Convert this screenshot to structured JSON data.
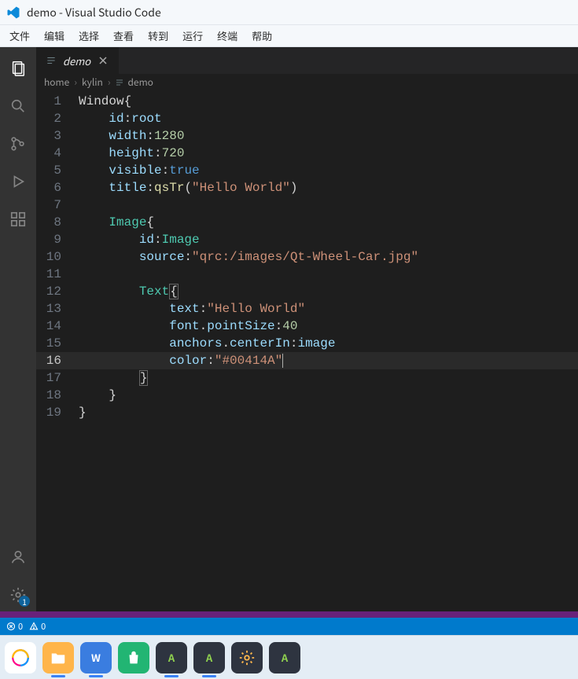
{
  "window": {
    "title": "demo - Visual Studio Code"
  },
  "menu": {
    "items": [
      "文件",
      "编辑",
      "选择",
      "查看",
      "转到",
      "运行",
      "终端",
      "帮助"
    ]
  },
  "activitybar": {
    "settings_badge": "1"
  },
  "tabs": [
    {
      "name": "demo"
    }
  ],
  "breadcrumbs": [
    "home",
    "kylin",
    "demo"
  ],
  "editor": {
    "lines": 19,
    "current_line": 16,
    "code": [
      {
        "i": 1,
        "indent": 0,
        "tokens": [
          [
            "ident",
            "Window"
          ],
          [
            "brace",
            "{"
          ]
        ]
      },
      {
        "i": 2,
        "indent": 2,
        "tokens": [
          [
            "attr",
            "id"
          ],
          [
            "plain",
            ":"
          ],
          [
            "val",
            "root"
          ]
        ]
      },
      {
        "i": 3,
        "indent": 2,
        "tokens": [
          [
            "attr",
            "width"
          ],
          [
            "plain",
            ":"
          ],
          [
            "num",
            "1280"
          ]
        ]
      },
      {
        "i": 4,
        "indent": 2,
        "tokens": [
          [
            "attr",
            "height"
          ],
          [
            "plain",
            ":"
          ],
          [
            "num",
            "720"
          ]
        ]
      },
      {
        "i": 5,
        "indent": 2,
        "tokens": [
          [
            "attr",
            "visible"
          ],
          [
            "plain",
            ":"
          ],
          [
            "bool",
            "true"
          ]
        ]
      },
      {
        "i": 6,
        "indent": 2,
        "tokens": [
          [
            "attr",
            "title"
          ],
          [
            "plain",
            ":"
          ],
          [
            "func",
            "qsTr"
          ],
          [
            "plain",
            "("
          ],
          [
            "str",
            "\"Hello World\""
          ],
          [
            "plain",
            ")"
          ]
        ]
      },
      {
        "i": 7,
        "indent": 0,
        "tokens": []
      },
      {
        "i": 8,
        "indent": 2,
        "tokens": [
          [
            "type",
            "Image"
          ],
          [
            "brace",
            "{"
          ]
        ]
      },
      {
        "i": 9,
        "indent": 4,
        "tokens": [
          [
            "attr",
            "id"
          ],
          [
            "plain",
            ":"
          ],
          [
            "type",
            "Image"
          ]
        ]
      },
      {
        "i": 10,
        "indent": 4,
        "tokens": [
          [
            "attr",
            "source"
          ],
          [
            "plain",
            ":"
          ],
          [
            "str",
            "\"qrc:/images/Qt-Wheel-Car.jpg\""
          ]
        ]
      },
      {
        "i": 11,
        "indent": 0,
        "tokens": []
      },
      {
        "i": 12,
        "indent": 4,
        "tokens": [
          [
            "type",
            "Text"
          ],
          [
            "braceHL",
            "{"
          ]
        ]
      },
      {
        "i": 13,
        "indent": 6,
        "tokens": [
          [
            "attr",
            "text"
          ],
          [
            "plain",
            ":"
          ],
          [
            "str",
            "\"Hello World\""
          ]
        ]
      },
      {
        "i": 14,
        "indent": 6,
        "tokens": [
          [
            "attr",
            "font"
          ],
          [
            "plain",
            "."
          ],
          [
            "attr",
            "pointSize"
          ],
          [
            "plain",
            ":"
          ],
          [
            "num",
            "40"
          ]
        ]
      },
      {
        "i": 15,
        "indent": 6,
        "tokens": [
          [
            "attr",
            "anchors"
          ],
          [
            "plain",
            "."
          ],
          [
            "attr",
            "centerIn"
          ],
          [
            "plain",
            ":"
          ],
          [
            "val",
            "image"
          ]
        ]
      },
      {
        "i": 16,
        "indent": 6,
        "tokens": [
          [
            "attr",
            "color"
          ],
          [
            "plain",
            ":"
          ],
          [
            "str",
            "\"#00414A\""
          ],
          [
            "cursor",
            ""
          ]
        ]
      },
      {
        "i": 17,
        "indent": 4,
        "tokens": [
          [
            "braceHL",
            "}"
          ]
        ]
      },
      {
        "i": 18,
        "indent": 2,
        "tokens": [
          [
            "brace",
            "}"
          ]
        ]
      },
      {
        "i": 19,
        "indent": 0,
        "tokens": [
          [
            "brace",
            "}"
          ]
        ]
      }
    ]
  },
  "statusbar": {
    "errors": "0",
    "warnings": "0"
  },
  "taskbar": {
    "apps": [
      {
        "name": "start-menu",
        "bg": "#ffffff",
        "letter": "",
        "dot": false,
        "icon": "kylin"
      },
      {
        "name": "files",
        "bg": "#ffb54a",
        "letter": "",
        "dot": true,
        "icon": "folder"
      },
      {
        "name": "wps",
        "bg": "#3a7de0",
        "letter": "W",
        "dot": true
      },
      {
        "name": "store",
        "bg": "#22b573",
        "letter": "",
        "dot": false,
        "icon": "bag"
      },
      {
        "name": "app-a1",
        "bg": "#2e3440",
        "letter": "A",
        "dot": true,
        "fg": "#8fd14f"
      },
      {
        "name": "app-a2",
        "bg": "#2e3440",
        "letter": "A",
        "dot": true,
        "fg": "#8fd14f"
      },
      {
        "name": "settings",
        "bg": "#2e3440",
        "letter": "",
        "dot": false,
        "icon": "gear"
      },
      {
        "name": "app-a3",
        "bg": "#2e3440",
        "letter": "A",
        "dot": false,
        "fg": "#8fd14f"
      }
    ]
  }
}
